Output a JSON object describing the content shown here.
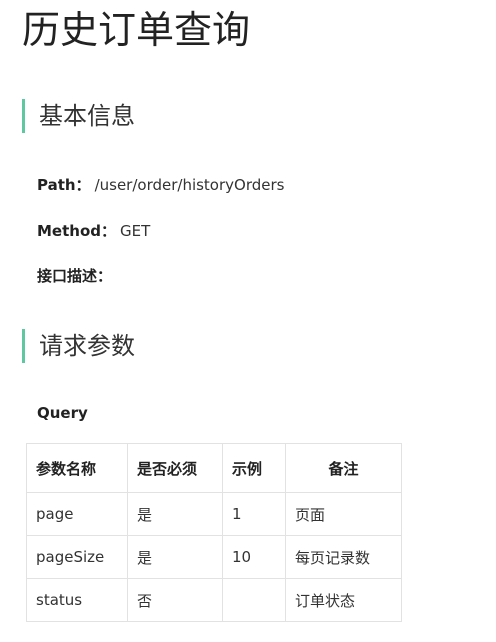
{
  "page": {
    "title": "历史订单查询"
  },
  "sections": {
    "basic": "基本信息",
    "params": "请求参数"
  },
  "info": {
    "path_key": "Path：",
    "path_value": "/user/order/historyOrders",
    "method_key": "Method：",
    "method_value": "GET",
    "desc_key": "接口描述："
  },
  "query": {
    "label": "Query",
    "headers": [
      "参数名称",
      "是否必须",
      "示例",
      "备注"
    ],
    "rows": [
      [
        "page",
        "是",
        "1",
        "页面"
      ],
      [
        "pageSize",
        "是",
        "10",
        "每页记录数"
      ],
      [
        "status",
        "否",
        "",
        "订单状态"
      ]
    ]
  },
  "colors": {
    "accent": "#5fc8a3",
    "border": "#e2e2e2"
  }
}
